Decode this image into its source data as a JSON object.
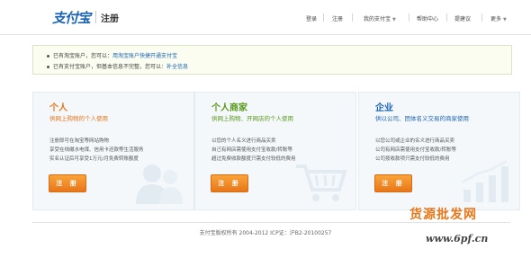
{
  "header": {
    "logo_text": "支付宝",
    "title": "注册",
    "nav": [
      "登录",
      "注册",
      "我的支付宝",
      "帮助中心",
      "提建议",
      "更多"
    ]
  },
  "notice": {
    "line1_prefix": "已有淘宝账户，您可以：",
    "line1_link": "用淘宝账户快捷开通支付宝",
    "line2_prefix": "已有支付宝账户，但基本信息不完整，您可以：",
    "line2_link": "补全信息"
  },
  "cards": [
    {
      "title": "个人",
      "subtitle": "供网上购物的个人使用",
      "desc": [
        "注册即可在淘宝等网站购物",
        "享受在线缴水电煤、信用卡还款等生活服务",
        "实名认证后可享受1万元/月免费转账额度"
      ],
      "button": "注 册",
      "color": "#e8761a"
    },
    {
      "title": "个人商家",
      "subtitle": "供网上购物、开网店的个人使用",
      "desc": [
        "以您的个人名义进行商品买卖",
        "自己有网店需使用支付宝收款/转账等",
        "超过免费收款额度只需支付较低的费用"
      ],
      "button": "注 册",
      "color": "#5a9a1c"
    },
    {
      "title": "企业",
      "subtitle": "供以公司、团体名义交易的商家使用",
      "desc": [
        "以您公司或企业的名义进行商品买卖",
        "公司有网店需使用支付宝收款/转账等",
        "公司按收款项只需支付较低的费用"
      ],
      "button": "注 册",
      "color": "#1b64b5"
    }
  ],
  "footer": "支付宝版权所有  2004-2012 ICP证：沪B2-20100257",
  "watermark": {
    "brand": "货源批发网",
    "url": "www.6pf.cn"
  }
}
